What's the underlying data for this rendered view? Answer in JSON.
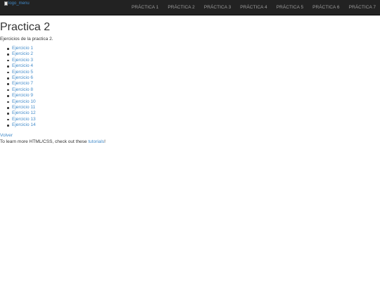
{
  "navbar": {
    "logo_alt": "logo_menu",
    "links": [
      "PRÁCTICA 1",
      "PRÁCTICA 2",
      "PRÁCTICA 3",
      "PRÁCTICA 4",
      "PRÁCTICA 5",
      "PRÁCTICA 6",
      "PRÁCTICA 7"
    ]
  },
  "main": {
    "title": "Practica 2",
    "intro": "Ejercicios de la practica 2.",
    "exercises": [
      "Ejercicio 1",
      "Ejercicio 2",
      "Ejercicio 3",
      "Ejercicio 4",
      "Ejercicio 5",
      "Ejercicio 6",
      "Ejercicio 7",
      "Ejercicio 8",
      "Ejercicio 9",
      "Ejercicio 10",
      "Ejercicio 11",
      "Ejercicio 12",
      "Ejercicio 13",
      "Ejercicio 14"
    ],
    "back_label": "Volver",
    "footer_prefix": "To learn more HTML/CSS, check out these ",
    "footer_link": "tutorials",
    "footer_suffix": "!"
  },
  "colors": {
    "navbar_bg": "#222222",
    "nav_text": "#9d9d9d",
    "link": "#428bca",
    "text": "#333333"
  }
}
